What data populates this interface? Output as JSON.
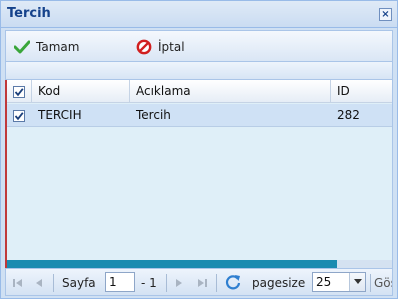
{
  "window": {
    "title": "Tercih",
    "close_icon": "close-icon"
  },
  "toolbar": {
    "ok_label": "Tamam",
    "cancel_label": "İptal",
    "ok_icon": "checkmark-icon",
    "cancel_icon": "forbidden-icon"
  },
  "grid": {
    "columns": [
      "Kod",
      "Acıklama",
      "ID"
    ],
    "header_checked": true,
    "rows": [
      {
        "checked": true,
        "kod": "TERCIH",
        "aciklama": "Tercih",
        "id": "282"
      }
    ]
  },
  "paging": {
    "page_label": "Sayfa",
    "page_value": "1",
    "page_total": "- 1",
    "pagesize_label": "pagesize",
    "pagesize_value": "25",
    "show_label": "Gös"
  },
  "colors": {
    "accent": "#15428b",
    "row_selected": "#cfe1f5",
    "scroll_thumb": "#1a8bb0"
  }
}
